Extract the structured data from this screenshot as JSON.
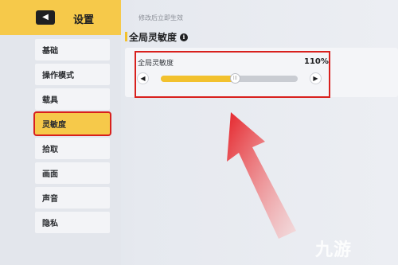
{
  "sidebar": {
    "title": "设置",
    "back_icon": "◀",
    "items": [
      {
        "label": "基础"
      },
      {
        "label": "操作模式"
      },
      {
        "label": "载具"
      },
      {
        "label": "灵敏度"
      },
      {
        "label": "拾取"
      },
      {
        "label": "画面"
      },
      {
        "label": "声音"
      },
      {
        "label": "隐私"
      }
    ],
    "active_index": 3
  },
  "main": {
    "hint": "修改后立即生效",
    "section_title": "全局灵敏度",
    "info_icon": "i",
    "slider": {
      "label": "全局灵敏度",
      "value_text": "110%",
      "fraction": 0.54,
      "left_arrow": "◀",
      "right_arrow": "▶",
      "thumb_mark": "|||"
    }
  },
  "watermark": "九游",
  "colors": {
    "accent": "#f6c94a",
    "highlight": "#d8201d"
  }
}
